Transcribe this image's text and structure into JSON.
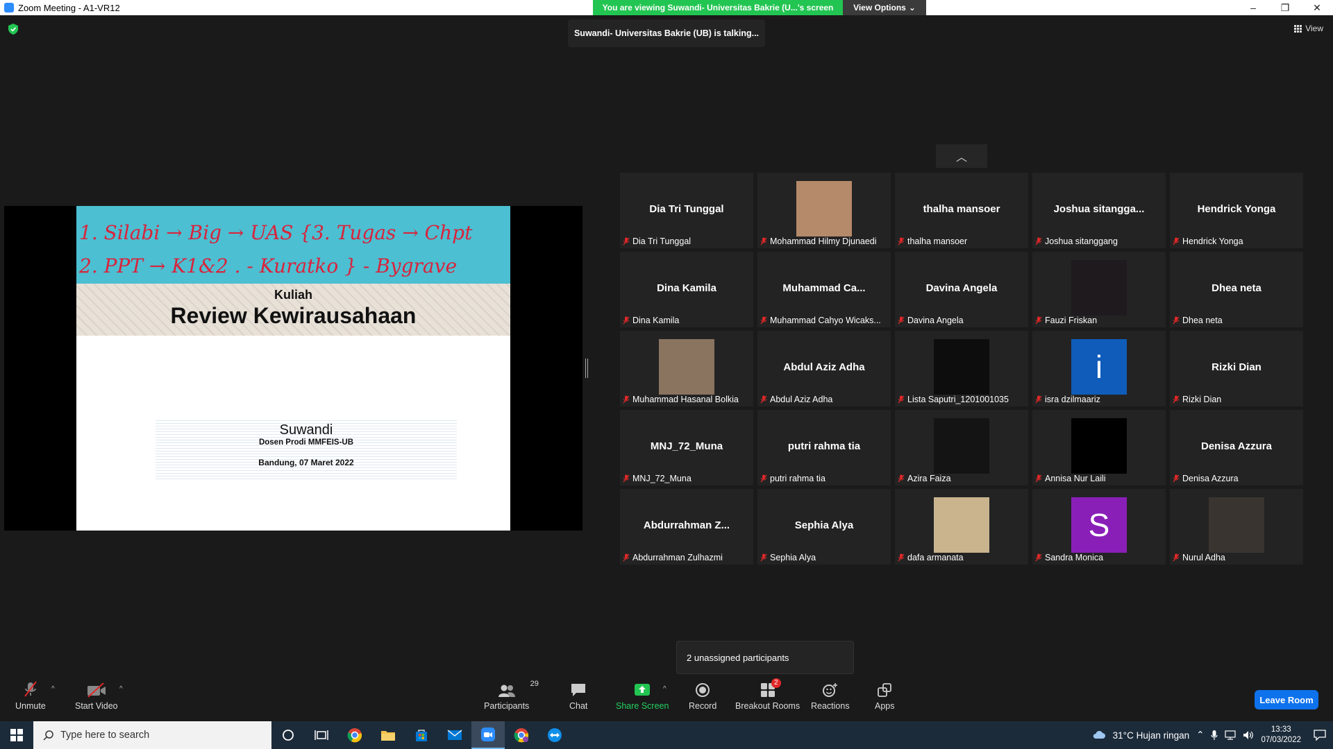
{
  "window": {
    "title": "Zoom Meeting - A1-VR12",
    "controls": [
      "–",
      "❐",
      "✕"
    ]
  },
  "share_banner": {
    "text": "You are viewing Suwandi- Universitas Bakrie (U...'s screen",
    "view_options": "View Options"
  },
  "talking_indicator": "Suwandi- Universitas Bakrie (UB) is talking...",
  "view_button": "View",
  "slide": {
    "handwriting_line1": "1. Silabi → Big → UAS {3. Tugas → Chpt",
    "handwriting_line2": "2. PPT → K1&2 . - Kuratko } - Bygrave",
    "kuliah": "Kuliah",
    "title": "Review Kewirausahaan",
    "author": "Suwandi",
    "role": "Dosen Prodi MMFEIS-UB",
    "date": "Bandung, 07 Maret 2022"
  },
  "participants": [
    {
      "display": "Dia Tri Tunggal",
      "label": "Dia Tri Tunggal",
      "kind": "name"
    },
    {
      "display": "",
      "label": "Mohammad Hilmy Djunaedi",
      "kind": "photo",
      "color": "#b58a6a"
    },
    {
      "display": "thalha mansoer",
      "label": "thalha mansoer",
      "kind": "name"
    },
    {
      "display": "Joshua  sitangga...",
      "label": "Joshua sitanggang",
      "kind": "name"
    },
    {
      "display": "Hendrick Yonga",
      "label": "Hendrick Yonga",
      "kind": "name"
    },
    {
      "display": "Dina Kamila",
      "label": "Dina Kamila",
      "kind": "name"
    },
    {
      "display": "Muhammad  Ca...",
      "label": "Muhammad Cahyo Wicaks...",
      "kind": "name"
    },
    {
      "display": "Davina Angela",
      "label": "Davina Angela",
      "kind": "name"
    },
    {
      "display": "",
      "label": "Fauzi Friskan",
      "kind": "photo",
      "color": "#1f1a1e"
    },
    {
      "display": "Dhea neta",
      "label": "Dhea neta",
      "kind": "name"
    },
    {
      "display": "",
      "label": "Muhammad Hasanal Bolkia",
      "kind": "photo",
      "color": "#8a7460"
    },
    {
      "display": "Abdul Aziz Adha",
      "label": "Abdul Aziz Adha",
      "kind": "name"
    },
    {
      "display": "",
      "label": "Lista Saputri_1201001035",
      "kind": "photo",
      "color": "#0d0d0d"
    },
    {
      "display": "i",
      "label": "isra dzilmaariz",
      "kind": "letter",
      "color": "#0f5cba"
    },
    {
      "display": "Rizki Dian",
      "label": "Rizki Dian",
      "kind": "name"
    },
    {
      "display": "MNJ_72_Muna",
      "label": "MNJ_72_Muna",
      "kind": "name"
    },
    {
      "display": "putri rahma tia",
      "label": "putri rahma tia",
      "kind": "name"
    },
    {
      "display": "",
      "label": "Azira Faiza",
      "kind": "photo",
      "color": "#141414"
    },
    {
      "display": "",
      "label": "Annisa Nur Laili",
      "kind": "photo",
      "color": "#000000"
    },
    {
      "display": "Denisa Azzura",
      "label": "Denisa Azzura",
      "kind": "name"
    },
    {
      "display": "Abdurrahman  Z...",
      "label": "Abdurrahman Zulhazmi",
      "kind": "name"
    },
    {
      "display": "Sephia Alya",
      "label": "Sephia Alya",
      "kind": "name"
    },
    {
      "display": "",
      "label": "dafa armanata",
      "kind": "photo",
      "color": "#c9b48e"
    },
    {
      "display": "S",
      "label": "Sandra Monica",
      "kind": "letter",
      "color": "#8a1fb8"
    },
    {
      "display": "",
      "label": "Nurul Adha",
      "kind": "photo",
      "color": "#3a3430"
    }
  ],
  "unassigned": "2 unassigned participants",
  "toolbar": {
    "unmute": "Unmute",
    "start_video": "Start Video",
    "participants": "Participants",
    "participants_count": "29",
    "chat": "Chat",
    "share_screen": "Share Screen",
    "record": "Record",
    "breakout_rooms": "Breakout Rooms",
    "breakout_badge": "2",
    "reactions": "Reactions",
    "apps": "Apps",
    "leave": "Leave Room"
  },
  "taskbar": {
    "search_placeholder": "Type here to search",
    "weather": "31°C  Hujan ringan",
    "time": "13:33",
    "date": "07/03/2022"
  },
  "colors": {
    "zoom_blue": "#0e72ed",
    "share_green": "#23c552",
    "mute_red": "#e02828"
  }
}
